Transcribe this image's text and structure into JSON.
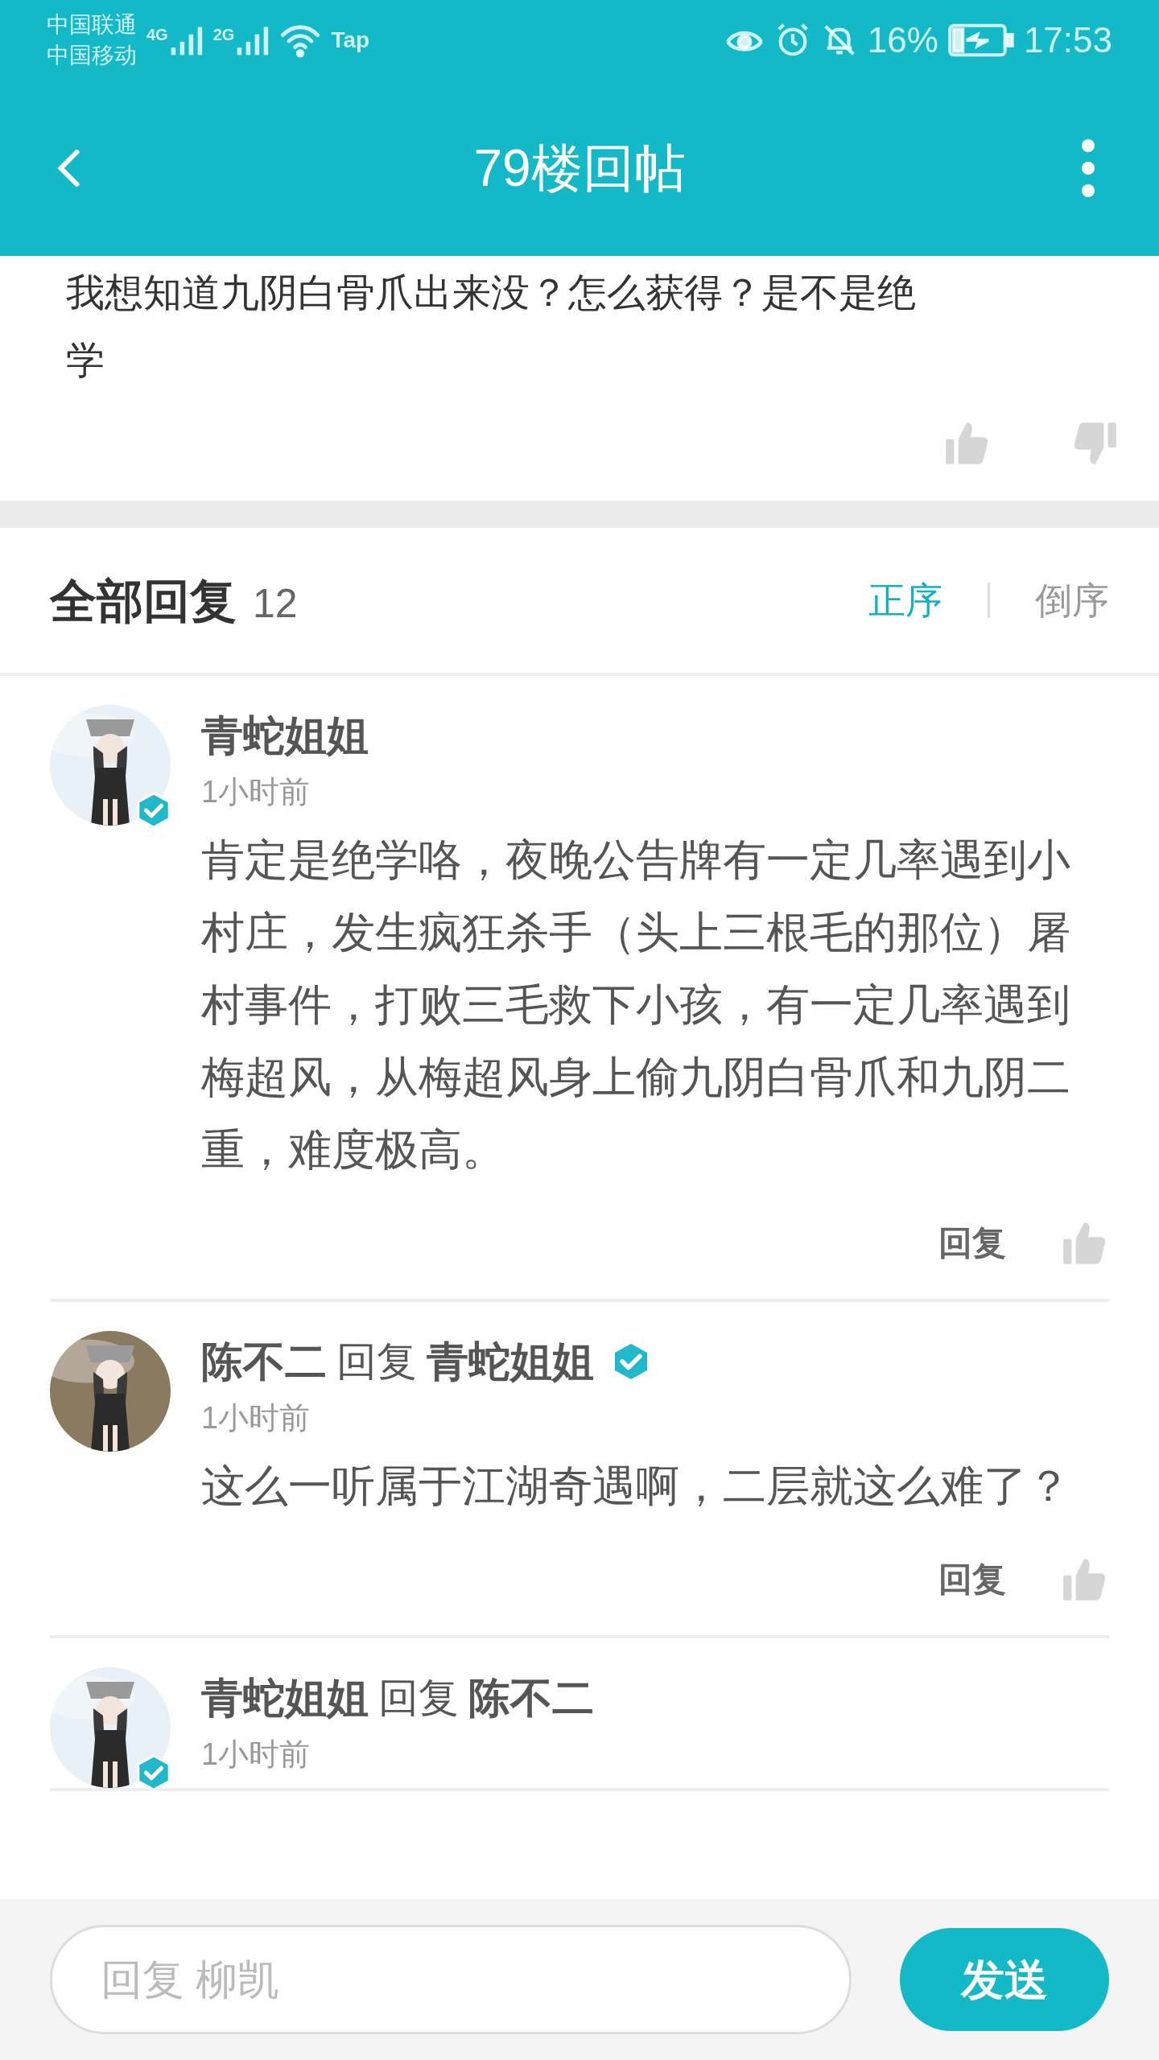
{
  "status_bar": {
    "carriers": [
      "中国联通",
      "中国移动"
    ],
    "networks": [
      "4G",
      "2G"
    ],
    "wifi_label": "Tap",
    "battery": "16%",
    "time": "17:53"
  },
  "header": {
    "title": "79楼回帖"
  },
  "post": {
    "text_lines": [
      "我想知道九阴白骨爪出来没？怎么获得？是不是绝",
      "学"
    ]
  },
  "replies_header": {
    "title": "全部回复",
    "count": "12",
    "sort": [
      {
        "label": "正序",
        "selected": true
      },
      {
        "label": "倒序",
        "selected": false
      }
    ]
  },
  "comments": [
    {
      "author": "青蛇姐姐",
      "author_verified": true,
      "time": "1小时前",
      "body": "肯定是绝学咯，夜晚公告牌有一定几率遇到小村庄，发生疯狂杀手（头上三根毛的那位）屠村事件，打败三毛救下小孩，有一定几率遇到梅超风，从梅超风身上偷九阴白骨爪和九阴二重，难度极高。",
      "reply_label": "回复"
    },
    {
      "author": "陈不二",
      "reply_word": "回复",
      "reply_to": "青蛇姐姐",
      "reply_to_verified": true,
      "time": "1小时前",
      "body": "这么一听属于江湖奇遇啊，二层就这么难了？",
      "reply_label": "回复"
    },
    {
      "author": "青蛇姐姐",
      "author_verified": true,
      "reply_word": "回复",
      "reply_to": "陈不二",
      "time": "1小时前"
    }
  ],
  "composer": {
    "placeholder": "回复 柳凯",
    "send": "发送"
  }
}
